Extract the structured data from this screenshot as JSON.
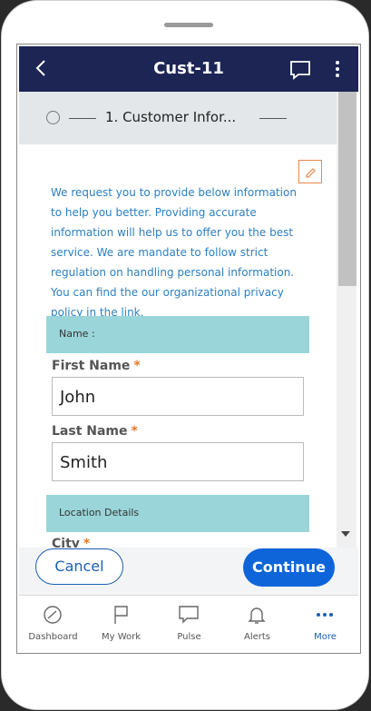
{
  "header": {
    "title": "Cust-11"
  },
  "stepper": {
    "label": "1. Customer Infor..."
  },
  "info_text": "We request you to provide below information to help you better. Providing accurate information will help us to offer you the best service. We are mandate to follow strict regulation on handling personal information. You can find the our organizational privacy policy in the link.",
  "sections": {
    "name": "Name :",
    "location": "Location Details"
  },
  "fields": {
    "first_name": {
      "label": "First Name",
      "required": "*",
      "value": "John"
    },
    "last_name": {
      "label": "Last Name",
      "required": "*",
      "value": "Smith"
    },
    "city": {
      "label": "City",
      "required": "*"
    }
  },
  "footer": {
    "cancel_label": "Cancel",
    "continue_label": "Continue"
  },
  "tabs": [
    {
      "label": "Dashboard",
      "icon": "dashboard-icon"
    },
    {
      "label": "My Work",
      "icon": "flag-icon"
    },
    {
      "label": "Pulse",
      "icon": "chat-icon"
    },
    {
      "label": "Alerts",
      "icon": "bell-icon"
    },
    {
      "label": "More",
      "icon": "more-icon"
    }
  ],
  "colors": {
    "header": "#1c2554",
    "accent": "#0d65d9",
    "section": "#99d5d9",
    "required": "#e07a2d",
    "info": "#2b7fc4"
  }
}
